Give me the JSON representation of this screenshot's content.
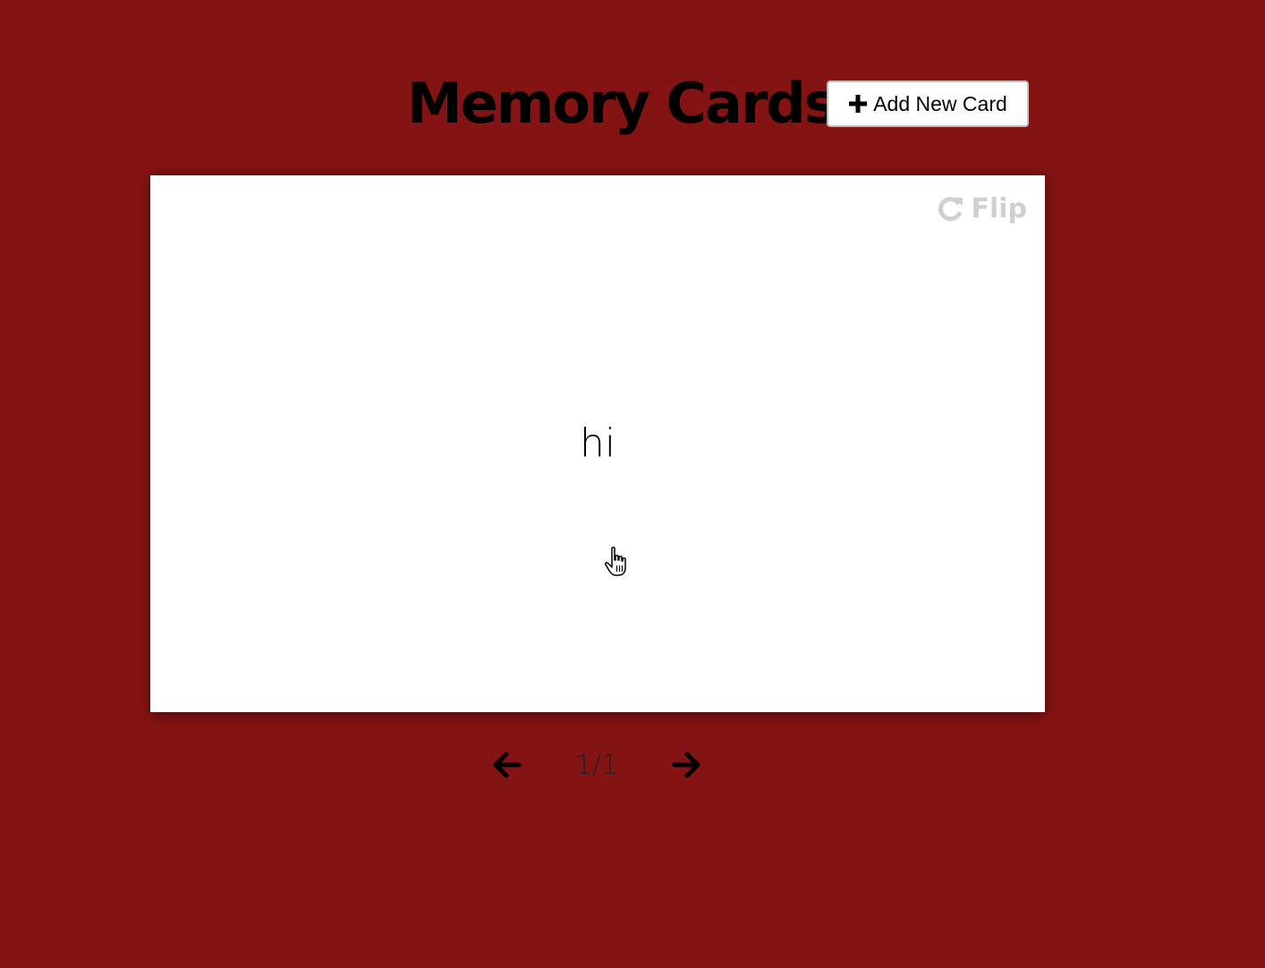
{
  "header": {
    "title": "Memory Cards",
    "add_button_label": "Add New Card",
    "add_button_icon": "plus-icon"
  },
  "card": {
    "text": "hi",
    "flip_label": "Flip",
    "flip_icon": "refresh-icon"
  },
  "navigation": {
    "prev_icon": "arrow-left-icon",
    "next_icon": "arrow-right-icon",
    "counter": "1/1"
  },
  "colors": {
    "background": "#841313",
    "card": "#ffffff",
    "flip_text": "#d0d0d0"
  }
}
